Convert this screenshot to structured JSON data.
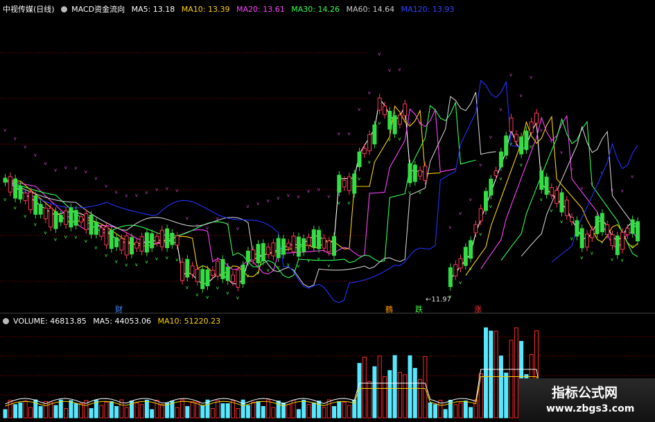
{
  "price_header": {
    "title": "中视传媒(日线)",
    "indicator": "MACD资金流向",
    "ma5_label": "MA5: 13.18",
    "ma10_label": "MA10: 13.39",
    "ma20_label": "MA20: 13.61",
    "ma30_label": "MA30: 14.26",
    "ma60_label": "MA60: 14.64",
    "ma120_label": "MA120: 13.93"
  },
  "volume_header": {
    "volume_label": "VOLUME: 46813.85",
    "ma5_label": "MA5: 44053.06",
    "ma10_label": "MA10: 51220.23"
  },
  "colors": {
    "up": "#ff3b5c",
    "down": "#33dd44",
    "ma5": "#ffffff",
    "ma10": "#ffd400",
    "ma20": "#ff44ff",
    "ma30": "#33ff55",
    "ma60": "#cccccc",
    "ma120": "#2233ff",
    "signal_up": "#ffa500",
    "grid": "#6a0000",
    "dots": "#44ff44",
    "upper_band": "#cc44cc",
    "vol_up": "#ff2a2a",
    "vol_down": "#55e8ff"
  },
  "signals": [
    {
      "text": "财",
      "color": "#4488ff"
    },
    {
      "text": "鶴",
      "color": "#ff9900"
    },
    {
      "text": "跌",
      "color": "#44ff44"
    },
    {
      "text": "涨",
      "color": "#ff3333"
    }
  ],
  "low_label": "11.97",
  "watermark": {
    "title": "指标公式网",
    "url": "www.zbgs3.com"
  }
}
